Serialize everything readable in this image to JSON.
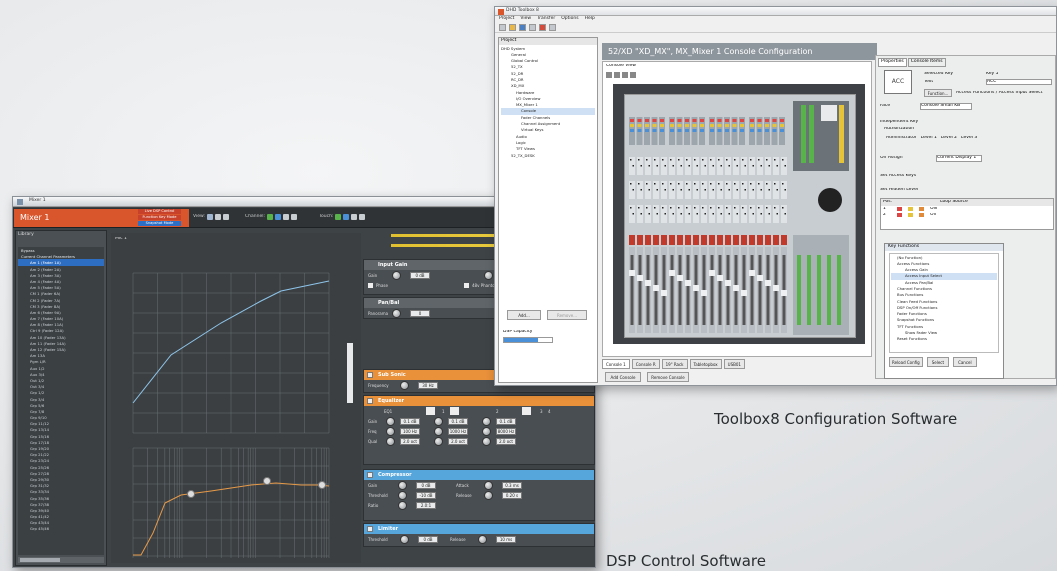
{
  "dsp_window": {
    "title": "Mixer 1",
    "header_title": "Mixer 1",
    "modes": [
      "Live DSP Control",
      "Function Key Mode",
      "Snapshot Mode"
    ],
    "toolbar_labels": [
      "View:",
      "Channel:",
      "Touch:"
    ],
    "sidebar": {
      "header": "Library",
      "items": [
        "Bypass",
        "Current Channel Parameters",
        "Am 1 (Fader 1A)",
        "Am 2 (Fader 2A)",
        "Am 3 (Fader 3A)",
        "Am 4 (Fader 4A)",
        "Am 5 (Fader 5A)",
        "CM 1 (Fader 6A)",
        "CM 2 (Fader 7A)",
        "CM 3 (Fader 8A)",
        "Am 6 (Fader 9A)",
        "Am 7 (Fader 10A)",
        "Am 8 (Fader 11A)",
        "Ctrl 9 (Fader 12A)",
        "Am 10 (Fader 13A)",
        "Am 11 (Fader 14A)",
        "Am 12 (Fader 15A)",
        "Am 13A",
        "Pgm L/R",
        "Aux 1/2",
        "Aux 3/4",
        "Out 1/2",
        "Out 3/4",
        "Grp 1/2",
        "Grp 3/4",
        "Grp 5/6",
        "Grp 7/8",
        "Grp 9/10",
        "Grp 11/12",
        "Grp 13/14",
        "Grp 15/16",
        "Grp 17/18",
        "Grp 19/20",
        "Grp 21/22",
        "Grp 23/24",
        "Grp 25/26",
        "Grp 27/28",
        "Grp 29/30",
        "Grp 31/32",
        "Grp 33/34",
        "Grp 35/36",
        "Grp 37/38",
        "Grp 39/40",
        "Grp 41/42",
        "Grp 43/44",
        "Grp 45/46"
      ],
      "selected_index": 2
    },
    "plot_label": "Mic 1",
    "sections": {
      "input_gain": {
        "title": "Input Gain",
        "gain_label": "Gain",
        "gain_value": "0 dB",
        "phase_label": "Phase",
        "phantom_label": "48v Phantom"
      },
      "pan_bal": {
        "title": "Pan/Bal",
        "pan_label": "Panorama",
        "pan_value": "0"
      },
      "sub_sonic": {
        "title": "Sub Sonic",
        "freq_label": "Frequency",
        "freq_value": "30 Hz"
      },
      "equalizer": {
        "title": "Equalizer",
        "bands": [
          "EQ1",
          "1",
          "2",
          "3",
          "4"
        ],
        "rows": [
          "Gain",
          "Freq",
          "Qual"
        ],
        "values": {
          "gain": [
            "0.1 dB",
            "0.1 dB",
            "0.1 dB"
          ],
          "freq": [
            "100 Hz",
            "1000 Hz",
            "8000 Hz"
          ],
          "qual": [
            "2.0 oct",
            "2.0 oct",
            "2.0 oct"
          ]
        }
      },
      "compressor": {
        "title": "Compressor",
        "rows": [
          [
            "Gain",
            "0 dB",
            "Attack",
            "0.3 ms"
          ],
          [
            "Threshold",
            "-10 dB",
            "Release",
            "0.20 s"
          ],
          [
            "Ratio",
            "2.0:1",
            "",
            ""
          ]
        ]
      },
      "limiter": {
        "title": "Limiter",
        "threshold_label": "Threshold",
        "threshold_value": "0 dB",
        "release_label": "Release",
        "release_value": "10 ms"
      }
    },
    "meter_label": "Limiter"
  },
  "toolbox_window": {
    "title": "DHD Toolbox 8",
    "menu": [
      "Project",
      "View",
      "Transfer",
      "Options",
      "Help"
    ],
    "project_label": "Project",
    "tree": [
      "DHD System",
      "General",
      "Global Control",
      "52_TX",
      "52_DR",
      "RC_DR",
      "XD_MX",
      "Hardware",
      "I/O Overview",
      "MX_Mixer 1",
      "Console",
      "Fader Channels",
      "Channel Assignment",
      "Virtual Keys",
      "Audio",
      "Logic",
      "TFT Views",
      "52_TX_DESK"
    ],
    "add_button": "Add...",
    "remove_button": "Remove...",
    "dsp_capacity_label": "DSP capacity",
    "config_header": "52/XD \"XD_MX\", MX_Mixer 1 Console Configuration",
    "console_view_label": "Console View",
    "console_tabs": [
      "Console 1",
      "Console R",
      "19\" Rack",
      "Tabletopbox",
      "USB01"
    ],
    "add_console": "Add Console",
    "remove_console": "Remove Console",
    "properties": {
      "tabs": [
        "Properties",
        "Console Items"
      ],
      "key_label": "ACC",
      "selected_key": "Selected Key",
      "key_no": "Key 5",
      "text_label": "Text",
      "text_value": "ACC",
      "function_button": "Function...",
      "function_value": "Access Functions / Access Input Select",
      "face_label": "Face",
      "face_value": "Console Small KB",
      "independent_key": "Independent Key",
      "authorization": "Authorization",
      "auth_opts": [
        "Administrator",
        "Level 1",
        "Level 2",
        "Level 3"
      ],
      "on_assign": "On Assign",
      "on_assign_value": "Current Display 1",
      "set_access": "Set Access Keys",
      "set_hidden": "Set Hidden Level",
      "table_headers": [
        "Pos.",
        "",
        "",
        "Loop Source"
      ],
      "table_rows": [
        [
          "1",
          "ON"
        ],
        [
          "2",
          "Off"
        ]
      ],
      "key_functions_title": "Key Functions",
      "key_functions": [
        "(No Function)",
        "Access Functions",
        "Access Gain",
        "Access Input Select",
        "Access Pan/Bal",
        "Channel Functions",
        "Bus Functions",
        "Clean Feed Functions",
        "DSP On/Off Functions",
        "Fader Functions",
        "Snapshot Functions",
        "TFT Functions",
        "Show Fader View",
        "Reset Functions"
      ],
      "reload_config": "Reload Config",
      "select_btn": "Select",
      "cancel_btn": "Cancel"
    }
  },
  "captions": {
    "toolbox": "Toolbox8 Configuration Software",
    "dsp": "DSP Control Software"
  },
  "colors": {
    "accent_orange": "#d9552b",
    "panel_dark": "#3e4346",
    "section_orange": "#e8903a",
    "section_blue": "#56a6dc",
    "selection_blue": "#2d6ec2"
  }
}
